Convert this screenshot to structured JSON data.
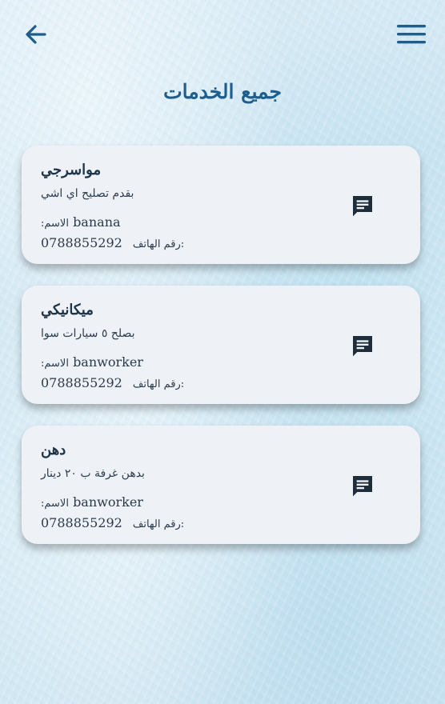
{
  "header": {
    "back_icon": "arrow-left-icon",
    "menu_icon": "hamburger-menu-icon",
    "title": "جميع الخدمات"
  },
  "colors": {
    "title": "#1f5d8c",
    "icon": "#1f5d8c",
    "card_bg": "#eef1f6",
    "chat_icon": "#1e2d3a"
  },
  "services": [
    {
      "title": "مواسرجي",
      "description": "بقدم تصليح اي اشي",
      "name_label": ":الاسم",
      "name": "banana",
      "phone_label": "رقم الهاتف:",
      "phone": "0788855292",
      "action_icon": "chat-message-icon"
    },
    {
      "title": "ميكانيكي",
      "description": "بصلح ٥ سيارات سوا",
      "name_label": ":الاسم",
      "name": "banworker",
      "phone_label": "رقم الهاتف:",
      "phone": "0788855292",
      "action_icon": "chat-message-icon"
    },
    {
      "title": "دهن",
      "description": "بدهن غرفة ب ٢٠ دينار",
      "name_label": ":الاسم",
      "name": "banworker",
      "phone_label": "رقم الهاتف:",
      "phone": "0788855292",
      "action_icon": "chat-message-icon"
    }
  ]
}
